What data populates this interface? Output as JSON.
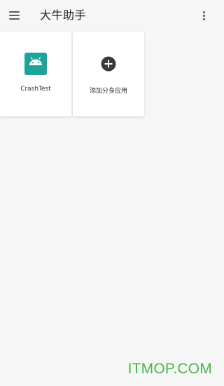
{
  "app": {
    "title": "大牛助手",
    "menu_icon": "hamburger-menu-icon",
    "more_icon": "more-vert-icon"
  },
  "apps": [
    {
      "label": "CrashTest",
      "icon": "android-icon",
      "icon_color": "#1fa29a"
    },
    {
      "label": "添加分身应用",
      "icon": "add-circle-icon",
      "icon_color": "#3a3a3a"
    }
  ],
  "watermark": "ITMOP.COM",
  "colors": {
    "background": "#f6f6f6",
    "card": "#ffffff",
    "watermark": "#47b749"
  }
}
